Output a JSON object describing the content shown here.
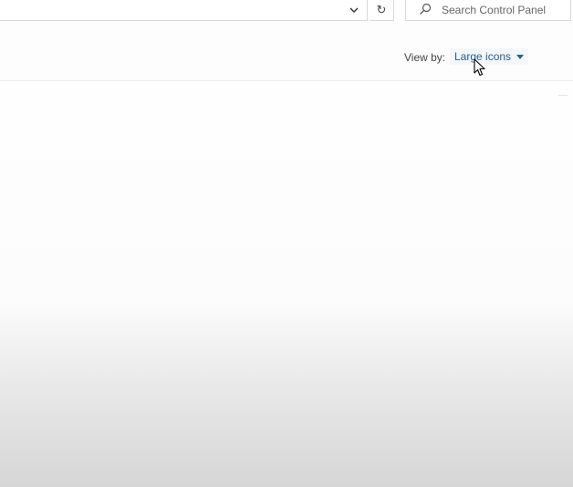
{
  "address_bar": {
    "chevron_icon": "chevron-down-icon",
    "refresh_icon": "refresh-icon",
    "refresh_glyph": "↻"
  },
  "search": {
    "placeholder": "Search Control Panel",
    "icon": "search-icon"
  },
  "view_options": {
    "label": "View by:",
    "selected": "Large icons",
    "caret_icon": "caret-down-icon"
  },
  "colors": {
    "link_blue": "#2a5d8f",
    "border": "#d9d9d9"
  }
}
